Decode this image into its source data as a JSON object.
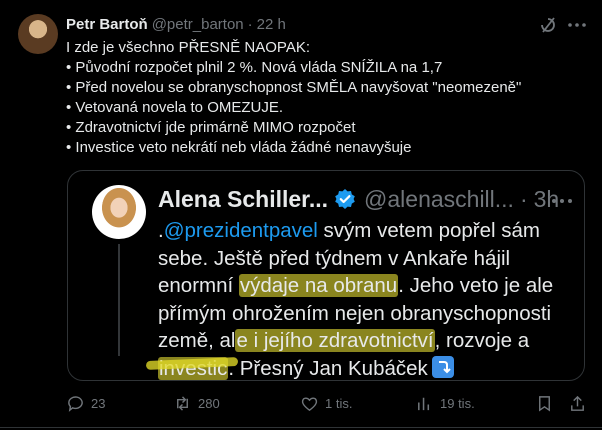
{
  "tweet": {
    "author": {
      "name": "Petr Bartoň",
      "handle": "@petr_barton",
      "separator": "·",
      "time": "22 h"
    },
    "lines": [
      "I zde je všechno PŘESNĚ NAOPAK:",
      "• Původní rozpočet plnil 2 %. Nová vláda SNÍŽILA na 1,7",
      "• Před novelou se obranyschopnost SMĚLA navyšovat \"neomezeně\"",
      "• Vetovaná novela to OMEZUJE.",
      "• Zdravotnictví jde primárně MIMO rozpočet",
      "• Investice veto nekrátí neb vláda žádné nenavyšuje"
    ]
  },
  "quote": {
    "author": {
      "name": "Alena Schiller...",
      "handle": "@alenaschill...",
      "separator": "·",
      "time": "3h"
    },
    "line1": {
      "prefix": ".",
      "mention": "@prezidentpavel",
      "rest": " svým vetem popřel sám"
    },
    "line2": "sebe. Ještě před týdnem v Ankaře hájil",
    "line3": {
      "before": "enormní ",
      "highlight": "výdaje na obranu",
      "after": ". Jeho veto je ale"
    },
    "line4": "přímým ohrožením nejen obranyschopnosti",
    "line5": {
      "before": "země, al",
      "highlight": "e i jejího zdravotnictví",
      "after": ", rozvoje a"
    },
    "line6": {
      "highlight": "investic",
      "after": ". Přesný Jan Kubáček"
    },
    "emoji": "arrow-curving-down-icon"
  },
  "actions": {
    "replies": "23",
    "reposts": "280",
    "likes": "1 tis.",
    "views": "19 tis."
  },
  "colors": {
    "background": "#000000",
    "text": "#e7e9ea",
    "muted": "#71767b",
    "accent": "#1d9bf0",
    "highlight": "#e5db2b"
  }
}
